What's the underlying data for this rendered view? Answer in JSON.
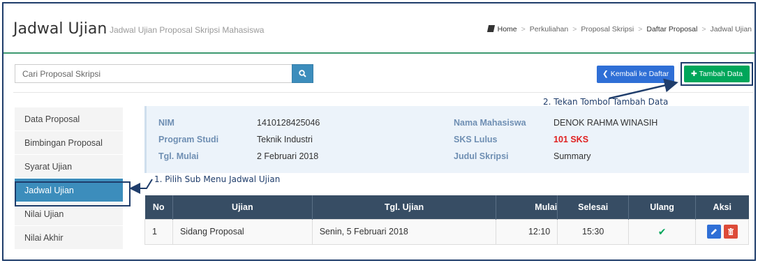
{
  "header": {
    "title": "Jadwal Ujian",
    "subtitle": "Jadwal Ujian Proposal Skripsi Mahasiswa",
    "breadcrumb": [
      "Home",
      "Perkuliahan",
      "Proposal Skripsi",
      "Daftar Proposal",
      "Jadwal Ujian"
    ]
  },
  "toolbar": {
    "search_placeholder": "Cari Proposal Skripsi",
    "back_label": "Kembali ke Daftar",
    "add_label": "Tambah Data"
  },
  "sidebar": {
    "items": [
      {
        "label": "Data Proposal"
      },
      {
        "label": "Bimbingan Proposal"
      },
      {
        "label": "Syarat Ujian"
      },
      {
        "label": "Jadwal Ujian"
      },
      {
        "label": "Nilai Ujian"
      },
      {
        "label": "Nilai Akhir"
      }
    ],
    "active_index": 3
  },
  "info": {
    "nim_label": "NIM",
    "nim": "1410128425046",
    "prodi_label": "Program Studi",
    "prodi": "Teknik Industri",
    "tgl_label": "Tgl. Mulai",
    "tgl": "2 Februari 2018",
    "nama_label": "Nama Mahasiswa",
    "nama": "DENOK RAHMA WINASIH",
    "sks_label": "SKS Lulus",
    "sks": "101 SKS",
    "judul_label": "Judul Skripsi",
    "judul": "Summary"
  },
  "annotations": {
    "step1": "1. Pilih Sub Menu Jadwal Ujian",
    "step2": "2. Tekan Tombol Tambah Data"
  },
  "table": {
    "headers": [
      "No",
      "Ujian",
      "Tgl. Ujian",
      "Mulai",
      "Selesai",
      "Ulang",
      "Aksi"
    ],
    "rows": [
      {
        "no": "1",
        "ujian": "Sidang Proposal",
        "tgl": "Senin, 5 Februari 2018",
        "mulai": "12:10",
        "selesai": "15:30",
        "ulang": "✔"
      }
    ]
  },
  "colors": {
    "primary": "#3c8dbc",
    "success": "#00a65a",
    "danger": "#dd4b39",
    "table_header": "#374d64",
    "annotation": "#1f3d6b"
  }
}
